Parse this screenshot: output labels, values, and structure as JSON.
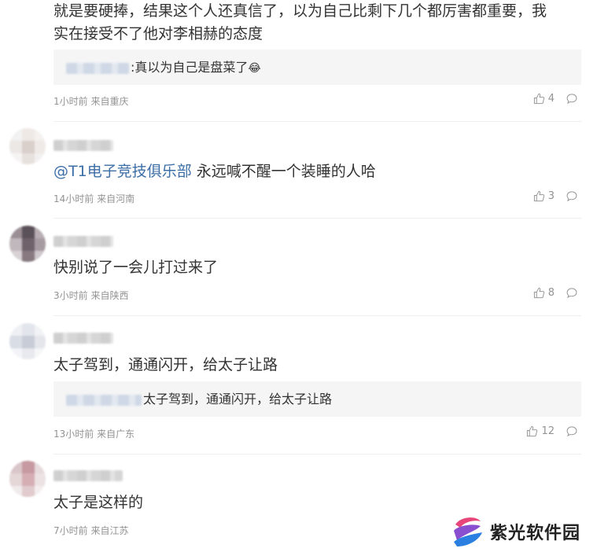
{
  "comments": [
    {
      "text_line1": "就是要硬捧，结果这个人还真信了，以为自己比剩下几个都厉害都重要，我",
      "text_line2": "实在接受不了他对李相赫的态度",
      "reply": {
        "text": ":真以为自己是盘菜了",
        "emoji": "😂"
      },
      "meta": "1小时前 来自重庆",
      "likes": "4"
    },
    {
      "mention": "@T1电子竞技俱乐部",
      "text": " 永远喊不醒一个装睡的人哈",
      "meta": "14小时前 来自河南",
      "likes": "3"
    },
    {
      "text": "快别说了一会儿打过来了",
      "meta": "3小时前 来自陕西",
      "likes": "8"
    },
    {
      "text": "太子驾到，通通闪开，给太子让路",
      "reply": {
        "text": "太子驾到，通通闪开，给太子让路"
      },
      "meta": "13小时前 来自广东",
      "likes": "12"
    },
    {
      "text": "太子是这样的",
      "meta": "7小时前 来自江苏"
    }
  ],
  "watermark": {
    "text": "紫光软件园"
  },
  "icons": {
    "like": "thumbs-up-icon",
    "comment": "comment-bubble-icon"
  }
}
